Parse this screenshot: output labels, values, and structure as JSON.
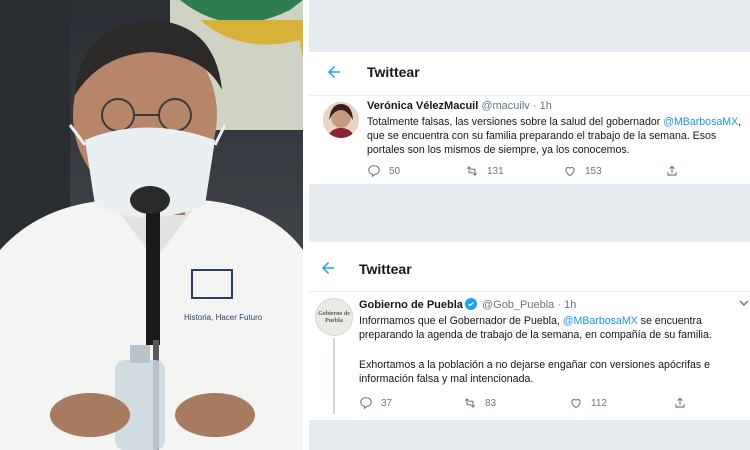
{
  "top_panel": {
    "header": {
      "title": "Twittear"
    },
    "tweet": {
      "author_name": "Verónica VélezMacuil",
      "handle": "@macuilv",
      "time": "1h",
      "text_before": "Totalmente falsas, las versiones sobre la salud del gobernador",
      "mention": "@MBarbosaMX",
      "text_after": ", que se encuentra con su familia preparando el trabajo de la semana. Esos portales son los mismos de siempre, ya los conocemos.",
      "reply_count": "50",
      "retweet_count": "131",
      "like_count": "153"
    }
  },
  "bottom_panel": {
    "header": {
      "title": "Twittear"
    },
    "tweet": {
      "author_name": "Gobierno de Puebla",
      "handle": "@Gob_Puebla",
      "time": "1h",
      "avatar_text": "Gobierno de Puebla",
      "text_before": "Informamos que el Gobernador de Puebla,",
      "mention": "@MBarbosaMX",
      "text_after": "se encuentra preparando la agenda de trabajo de la semana, en compañía de su familia.",
      "text_paragraph2": "Exhortamos a la población a no dejarse engañar con versiones apócrifas e información falsa y mal intencionada.",
      "reply_count": "37",
      "retweet_count": "83",
      "like_count": "112"
    }
  },
  "photo": {
    "shirt_text": "Historia, Hacer Futuro"
  },
  "colors": {
    "twitter_blue": "#1da1f2",
    "mention_blue": "#1b95e0",
    "text_dark": "#14171a",
    "text_muted": "#657786",
    "divider_gray": "#e6ecf0"
  }
}
